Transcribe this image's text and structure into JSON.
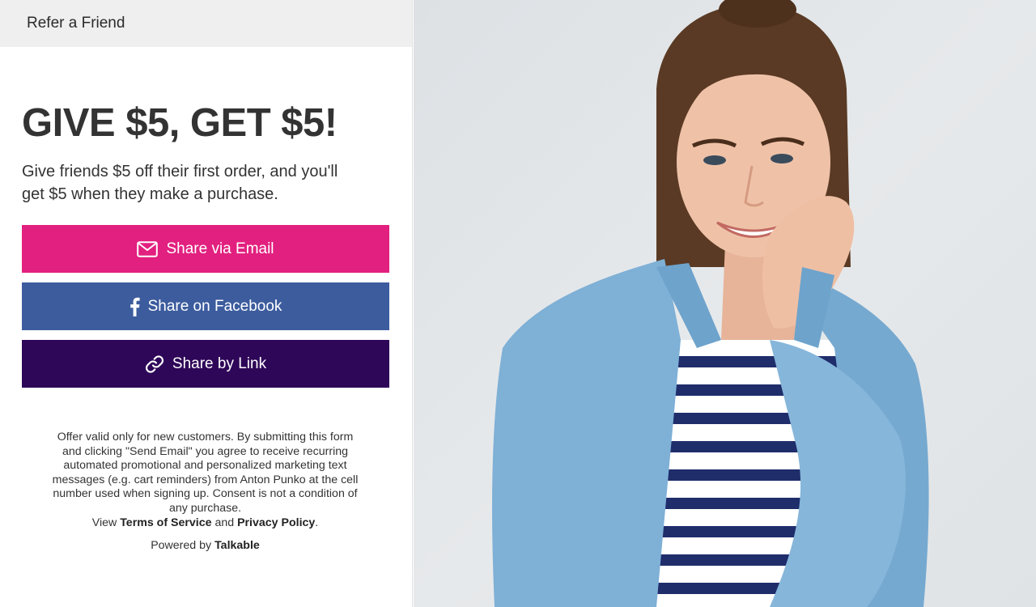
{
  "header": {
    "title": "Refer a Friend"
  },
  "main": {
    "headline": "GIVE $5, GET $5!",
    "subtext": "Give friends $5 off their first order, and you'll get $5 when they make a purchase."
  },
  "buttons": {
    "email": {
      "label": "Share via Email",
      "icon": "envelope-icon",
      "color": "#e2207f"
    },
    "facebook": {
      "label": "Share on Facebook",
      "icon": "facebook-icon",
      "color": "#3c5c9e"
    },
    "link": {
      "label": "Share by Link",
      "icon": "link-icon",
      "color": "#2e0758"
    }
  },
  "legal": {
    "text": "Offer valid only for new customers. By submitting this form and clicking \"Send Email\" you agree to receive recurring automated promotional and personalized marketing text messages (e.g. cart reminders) from Anton Punko at the cell number used when signing up. Consent is not a condition of any purchase.",
    "view_prefix": "View",
    "terms": "Terms of Service",
    "and": "and",
    "privacy": "Privacy Policy",
    "period": "."
  },
  "powered": {
    "prefix": "Powered by",
    "brand": "Talkable"
  }
}
